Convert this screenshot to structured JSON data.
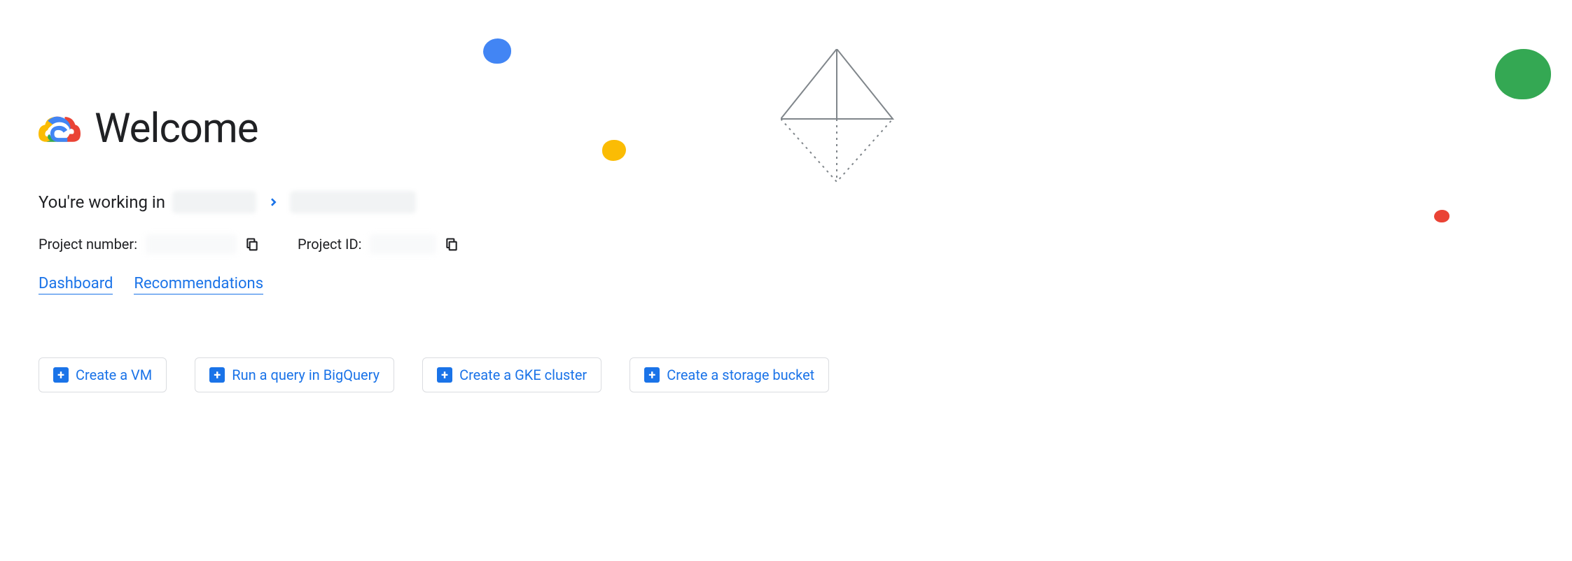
{
  "header": {
    "title": "Welcome"
  },
  "workingIn": {
    "prefix": "You're working in"
  },
  "projectInfo": {
    "numberLabel": "Project number:",
    "idLabel": "Project ID:"
  },
  "links": {
    "dashboard": "Dashboard",
    "recommendations": "Recommendations"
  },
  "actions": {
    "createVm": "Create a VM",
    "runQuery": "Run a query in BigQuery",
    "createGke": "Create a GKE cluster",
    "createBucket": "Create a storage bucket"
  }
}
